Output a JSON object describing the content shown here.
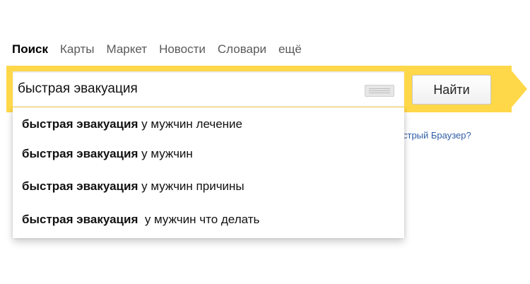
{
  "nav": {
    "items": [
      "Поиск",
      "Карты",
      "Маркет",
      "Новости",
      "Словари",
      "ещё"
    ]
  },
  "search": {
    "value": "быстрая эвакуация",
    "button_label": "Найти"
  },
  "suggestions": [
    {
      "bold": "быстрая эвакуация",
      "rest": " у мужчин лечение"
    },
    {
      "bold": "быстрая эвакуация",
      "rest": " у мужчин"
    },
    {
      "bold": "быстрая эвакуация",
      "rest": " у мужчин причины"
    },
    {
      "bold": "быстрая эвакуация",
      "rest": "  у мужчин что делать"
    }
  ],
  "promo": {
    "text": "стрый Браузер?"
  },
  "colors": {
    "accent_yellow": "#ffd84a"
  },
  "icons": [
    "keyboard-icon"
  ]
}
